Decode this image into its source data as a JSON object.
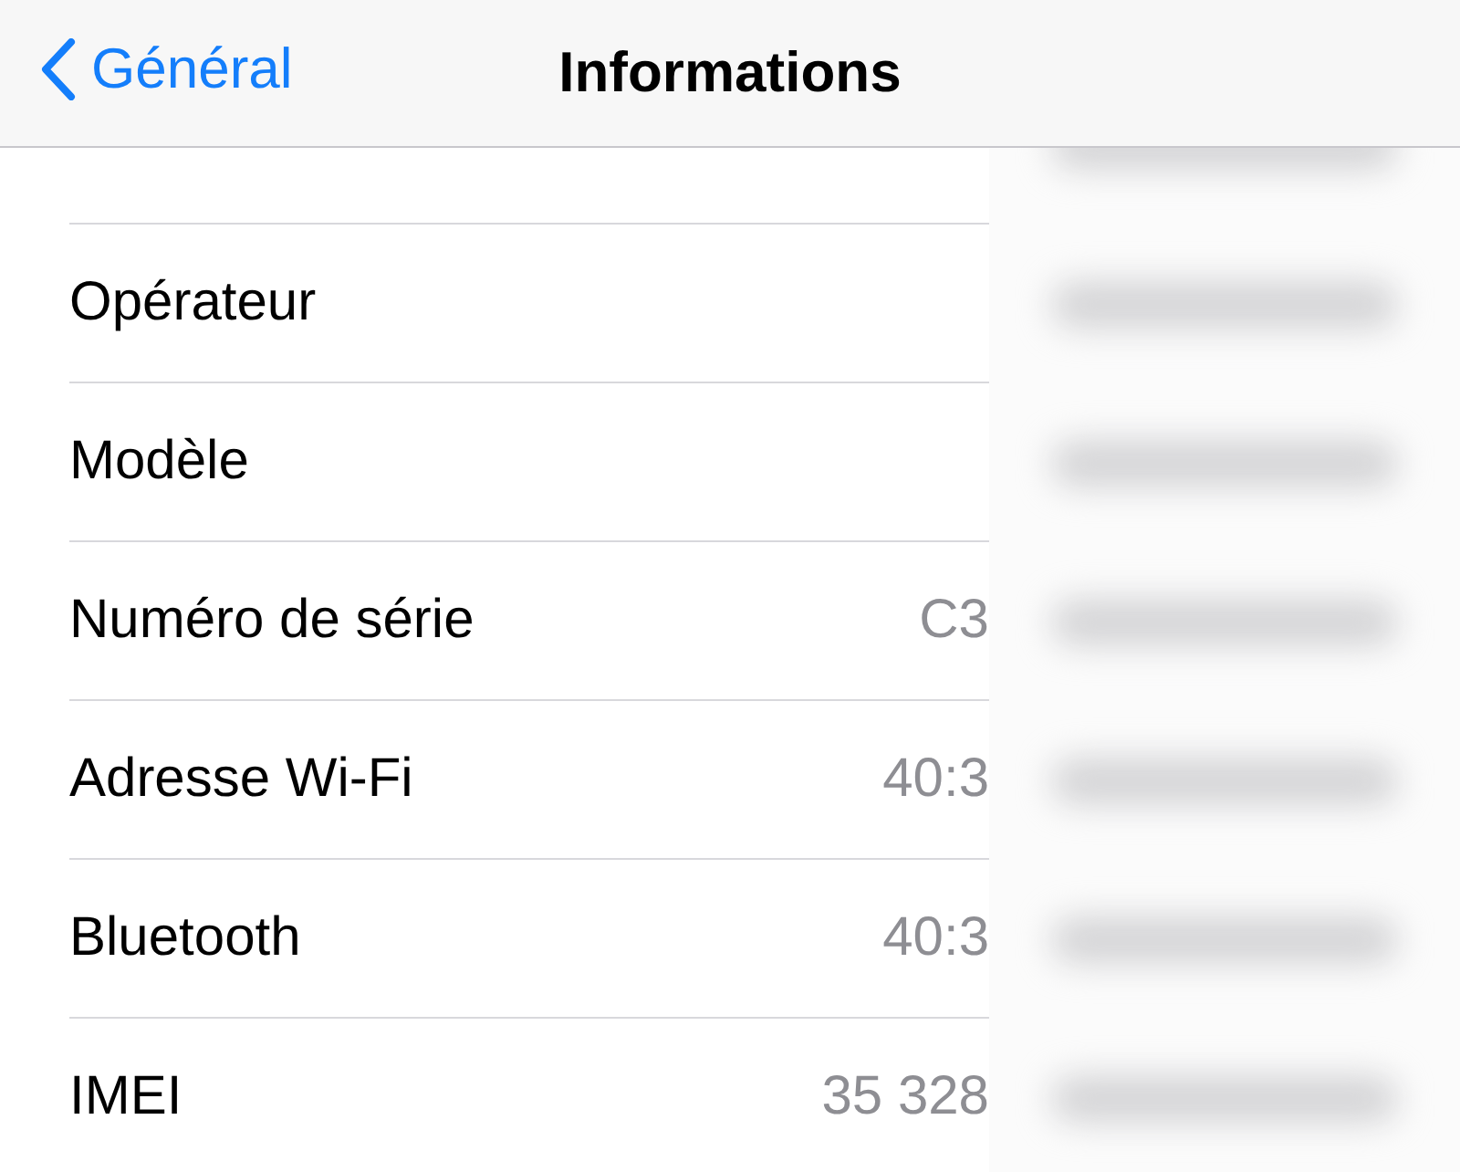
{
  "nav_bar": {
    "back_label": "Général",
    "title": "Informations"
  },
  "rows": [
    {
      "label": "Opérateur",
      "value": ""
    },
    {
      "label": "Modèle",
      "value": ""
    },
    {
      "label": "Numéro de série",
      "value": "C3"
    },
    {
      "label": "Adresse Wi-Fi",
      "value": "40:3"
    },
    {
      "label": "Bluetooth",
      "value": "40:3"
    },
    {
      "label": "IMEI",
      "value": "35 328"
    }
  ]
}
